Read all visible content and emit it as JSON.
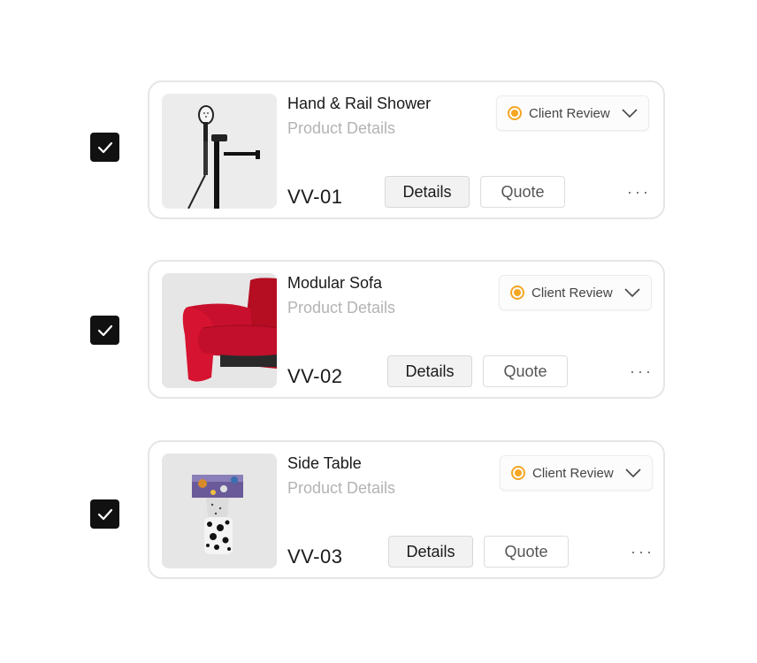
{
  "items": [
    {
      "title": "Hand & Rail Shower",
      "subtitle": "Product Details",
      "code": "VV-01",
      "status": "Client Review",
      "details_label": "Details",
      "quote_label": "Quote",
      "more_label": "···",
      "checked": true
    },
    {
      "title": "Modular Sofa",
      "subtitle": "Product Details",
      "code": "VV-02",
      "status": "Client Review",
      "details_label": "Details",
      "quote_label": "Quote",
      "more_label": "···",
      "checked": true
    },
    {
      "title": "Side Table",
      "subtitle": "Product Details",
      "code": "VV-03",
      "status": "Client Review",
      "details_label": "Details",
      "quote_label": "Quote",
      "more_label": "···",
      "checked": true
    }
  ],
  "colors": {
    "status_accent": "#f5a623",
    "checkbox": "#111111",
    "card_border": "#e6e6e6",
    "sofa_red": "#c8102e"
  },
  "icons": {
    "checkbox": "checkmark-icon",
    "status": "status-dot-icon",
    "dropdown": "chevron-down-icon",
    "more": "more-horizontal-icon"
  }
}
